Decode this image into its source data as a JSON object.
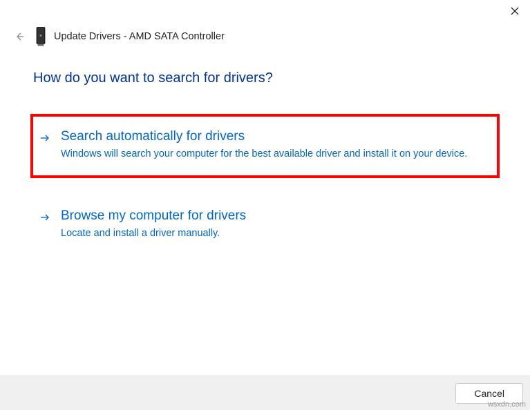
{
  "window": {
    "title": "Update Drivers - AMD SATA Controller"
  },
  "content": {
    "question": "How do you want to search for drivers?",
    "options": [
      {
        "title": "Search automatically for drivers",
        "description": "Windows will search your computer for the best available driver and install it on your device."
      },
      {
        "title": "Browse my computer for drivers",
        "description": "Locate and install a driver manually."
      }
    ]
  },
  "footer": {
    "cancel_label": "Cancel"
  },
  "watermark": "wsxdn.com"
}
